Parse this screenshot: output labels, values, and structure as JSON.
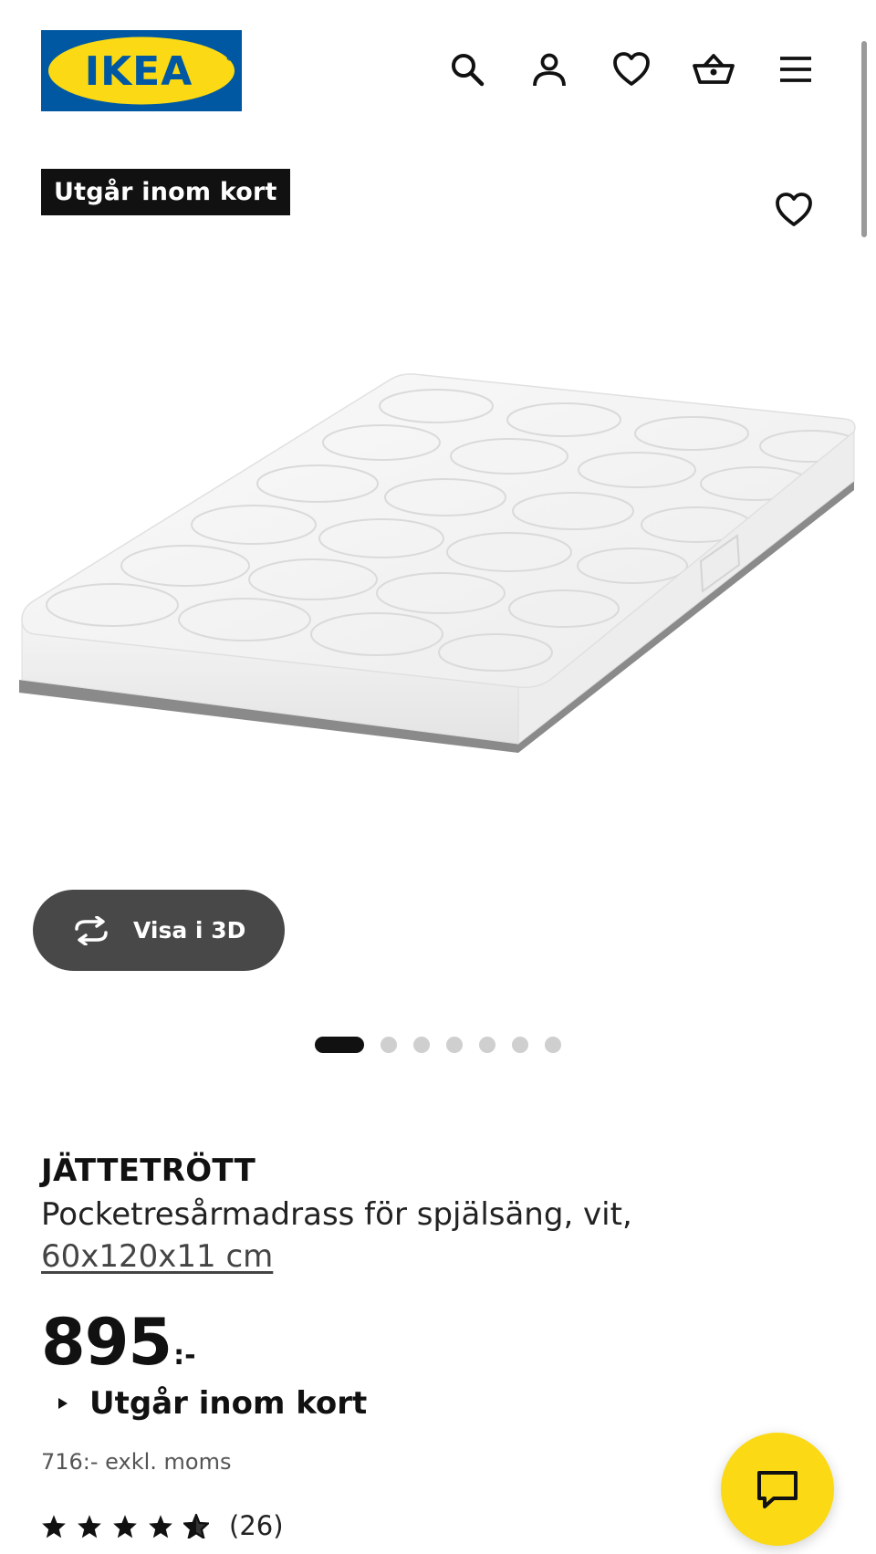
{
  "header": {
    "logo_text": "IKEA",
    "icons": [
      "search-icon",
      "account-icon",
      "heart-icon",
      "basket-icon",
      "menu-icon"
    ]
  },
  "badge": {
    "label": "Utgår inom kort"
  },
  "view3d": {
    "label": "Visa i 3D"
  },
  "carousel": {
    "total": 7,
    "active": 1
  },
  "product": {
    "name": "JÄTTETRÖTT",
    "description": "Pocketresårmadrass för spjälsäng, vit,",
    "size": "60x120x11 cm",
    "price_integer": "895",
    "price_suffix": ":-",
    "availability": "Utgår inom kort",
    "price_excl_vat": "716:- exkl. moms",
    "rating": {
      "stars": 4.5,
      "max": 5,
      "count": "(26)"
    }
  },
  "colors": {
    "ikea_blue": "#0058a3",
    "ikea_yellow": "#fbd914",
    "button_dark": "#484848",
    "text": "#111111"
  }
}
